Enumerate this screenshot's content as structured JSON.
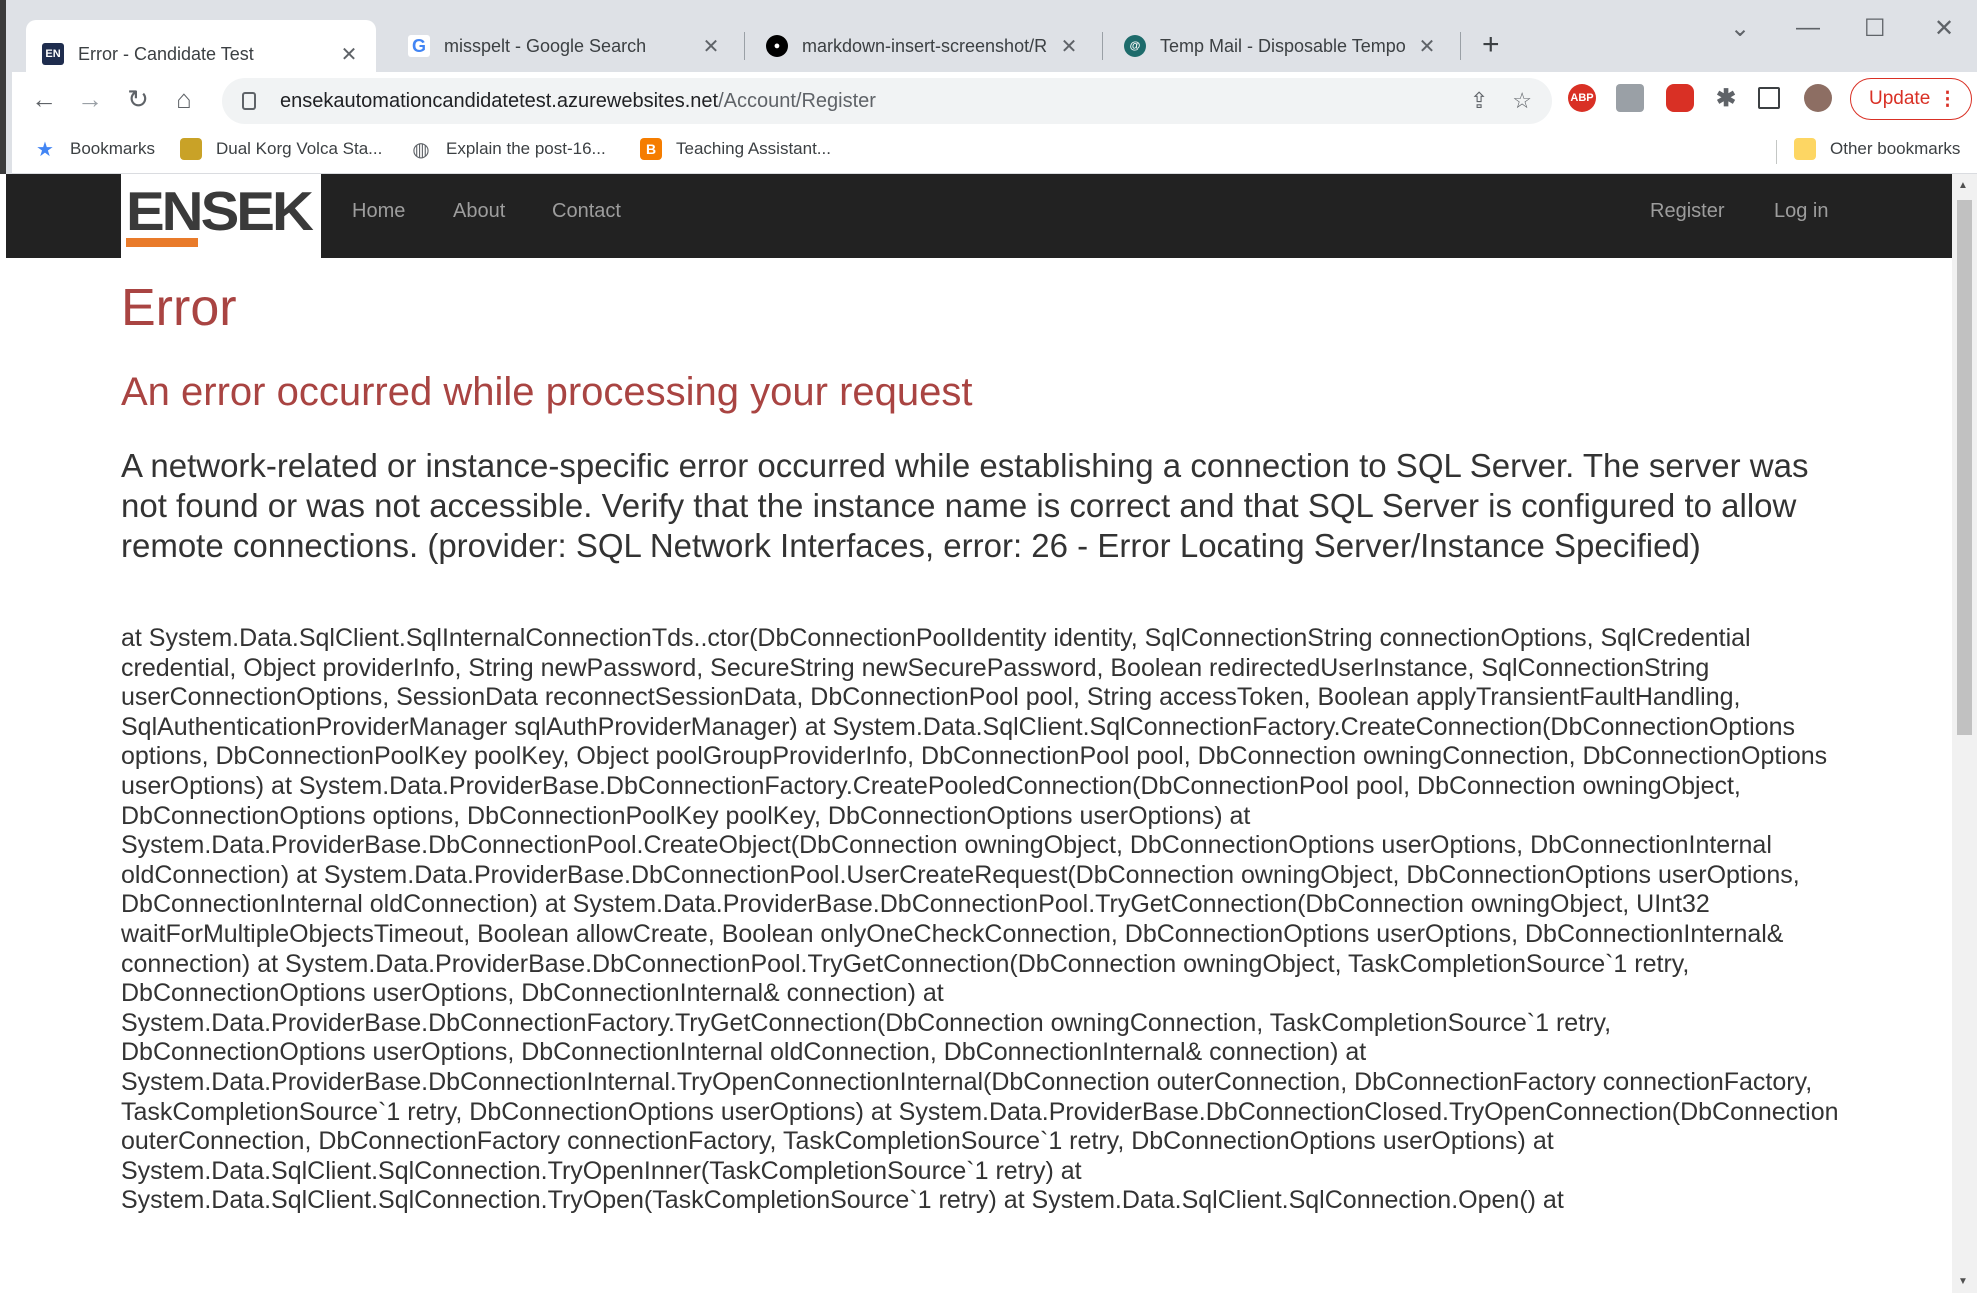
{
  "browser": {
    "tabs": [
      {
        "title": "Error - Candidate Test",
        "icon": "ensek-favicon",
        "active": true
      },
      {
        "title": "misspelt - Google Search",
        "icon": "google-favicon",
        "active": false
      },
      {
        "title": "markdown-insert-screenshot/REA",
        "icon": "github-favicon",
        "active": false
      },
      {
        "title": "Temp Mail - Disposable Tempora",
        "icon": "tempmail-favicon",
        "active": false
      }
    ],
    "url_host": "ensekautomationcandidatetest.azurewebsites.net",
    "url_path": "/Account/Register",
    "update_label": "Update",
    "extensions": [
      {
        "name": "abp-icon",
        "label": "ABP",
        "color": "#d93025"
      }
    ],
    "bookmarks": [
      {
        "label": "Bookmarks",
        "icon": "star-icon"
      },
      {
        "label": "Dual Korg Volca Sta...",
        "icon": "bookmark-image-icon"
      },
      {
        "label": "Explain the post-16...",
        "icon": "globe-icon"
      },
      {
        "label": "Teaching Assistant...",
        "icon": "blogger-icon"
      }
    ],
    "other_bookmarks": "Other bookmarks"
  },
  "site": {
    "logo_text": "ENSEK",
    "nav": {
      "home": "Home",
      "about": "About",
      "contact": "Contact",
      "register": "Register",
      "login": "Log in"
    },
    "colors": {
      "navbar": "#222222",
      "error_red": "#a94442",
      "logo_orange": "#e97b2a"
    }
  },
  "error": {
    "heading": "Error",
    "subheading": "An error occurred while processing your request",
    "message": "A network-related or instance-specific error occurred while establishing a connection to SQL Server. The server was not found or was not accessible. Verify that the instance name is correct and that SQL Server is configured to allow remote connections. (provider: SQL Network Interfaces, error: 26 - Error Locating Server/Instance Specified)",
    "stack_trace": "at System.Data.SqlClient.SqlInternalConnectionTds..ctor(DbConnectionPoolIdentity identity, SqlConnectionString connectionOptions, SqlCredential credential, Object providerInfo, String newPassword, SecureString newSecurePassword, Boolean redirectedUserInstance, SqlConnectionString userConnectionOptions, SessionData reconnectSessionData, DbConnectionPool pool, String accessToken, Boolean applyTransientFaultHandling, SqlAuthenticationProviderManager sqlAuthProviderManager) at System.Data.SqlClient.SqlConnectionFactory.CreateConnection(DbConnectionOptions options, DbConnectionPoolKey poolKey, Object poolGroupProviderInfo, DbConnectionPool pool, DbConnection owningConnection, DbConnectionOptions userOptions) at System.Data.ProviderBase.DbConnectionFactory.CreatePooledConnection(DbConnectionPool pool, DbConnection owningObject, DbConnectionOptions options, DbConnectionPoolKey poolKey, DbConnectionOptions userOptions) at System.Data.ProviderBase.DbConnectionPool.CreateObject(DbConnection owningObject, DbConnectionOptions userOptions, DbConnectionInternal oldConnection) at System.Data.ProviderBase.DbConnectionPool.UserCreateRequest(DbConnection owningObject, DbConnectionOptions userOptions, DbConnectionInternal oldConnection) at System.Data.ProviderBase.DbConnectionPool.TryGetConnection(DbConnection owningObject, UInt32 waitForMultipleObjectsTimeout, Boolean allowCreate, Boolean onlyOneCheckConnection, DbConnectionOptions userOptions, DbConnectionInternal& connection) at System.Data.ProviderBase.DbConnectionPool.TryGetConnection(DbConnection owningObject, TaskCompletionSource`1 retry, DbConnectionOptions userOptions, DbConnectionInternal& connection) at System.Data.ProviderBase.DbConnectionFactory.TryGetConnection(DbConnection owningConnection, TaskCompletionSource`1 retry, DbConnectionOptions userOptions, DbConnectionInternal oldConnection, DbConnectionInternal& connection) at System.Data.ProviderBase.DbConnectionInternal.TryOpenConnectionInternal(DbConnection outerConnection, DbConnectionFactory connectionFactory, TaskCompletionSource`1 retry, DbConnectionOptions userOptions) at System.Data.ProviderBase.DbConnectionClosed.TryOpenConnection(DbConnection outerConnection, DbConnectionFactory connectionFactory, TaskCompletionSource`1 retry, DbConnectionOptions userOptions) at System.Data.SqlClient.SqlConnection.TryOpenInner(TaskCompletionSource`1 retry) at System.Data.SqlClient.SqlConnection.TryOpen(TaskCompletionSource`1 retry) at System.Data.SqlClient.SqlConnection.Open() at"
  }
}
